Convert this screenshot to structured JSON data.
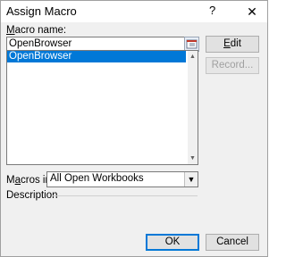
{
  "window": {
    "title": "Assign Macro",
    "help_label": "?",
    "close_label": "✕"
  },
  "macro_name": {
    "label_underlined": "M",
    "label_rest": "acro name:",
    "value": "OpenBrowser"
  },
  "macro_list": {
    "items": [
      "OpenBrowser"
    ],
    "selected_index": 0
  },
  "buttons": {
    "edit_underlined": "E",
    "edit_rest": "dit",
    "record": "Record...",
    "ok": "OK",
    "cancel": "Cancel"
  },
  "macros_in": {
    "label_pre": "M",
    "label_underlined": "a",
    "label_rest": "cros in:",
    "value": "All Open Workbooks"
  },
  "description": {
    "label": "Description"
  },
  "icons": {
    "picker": "range-picker-icon",
    "scroll_up": "scroll-up-icon",
    "scroll_down": "scroll-down-icon",
    "dropdown": "chevron-down-icon",
    "close": "close-icon"
  }
}
